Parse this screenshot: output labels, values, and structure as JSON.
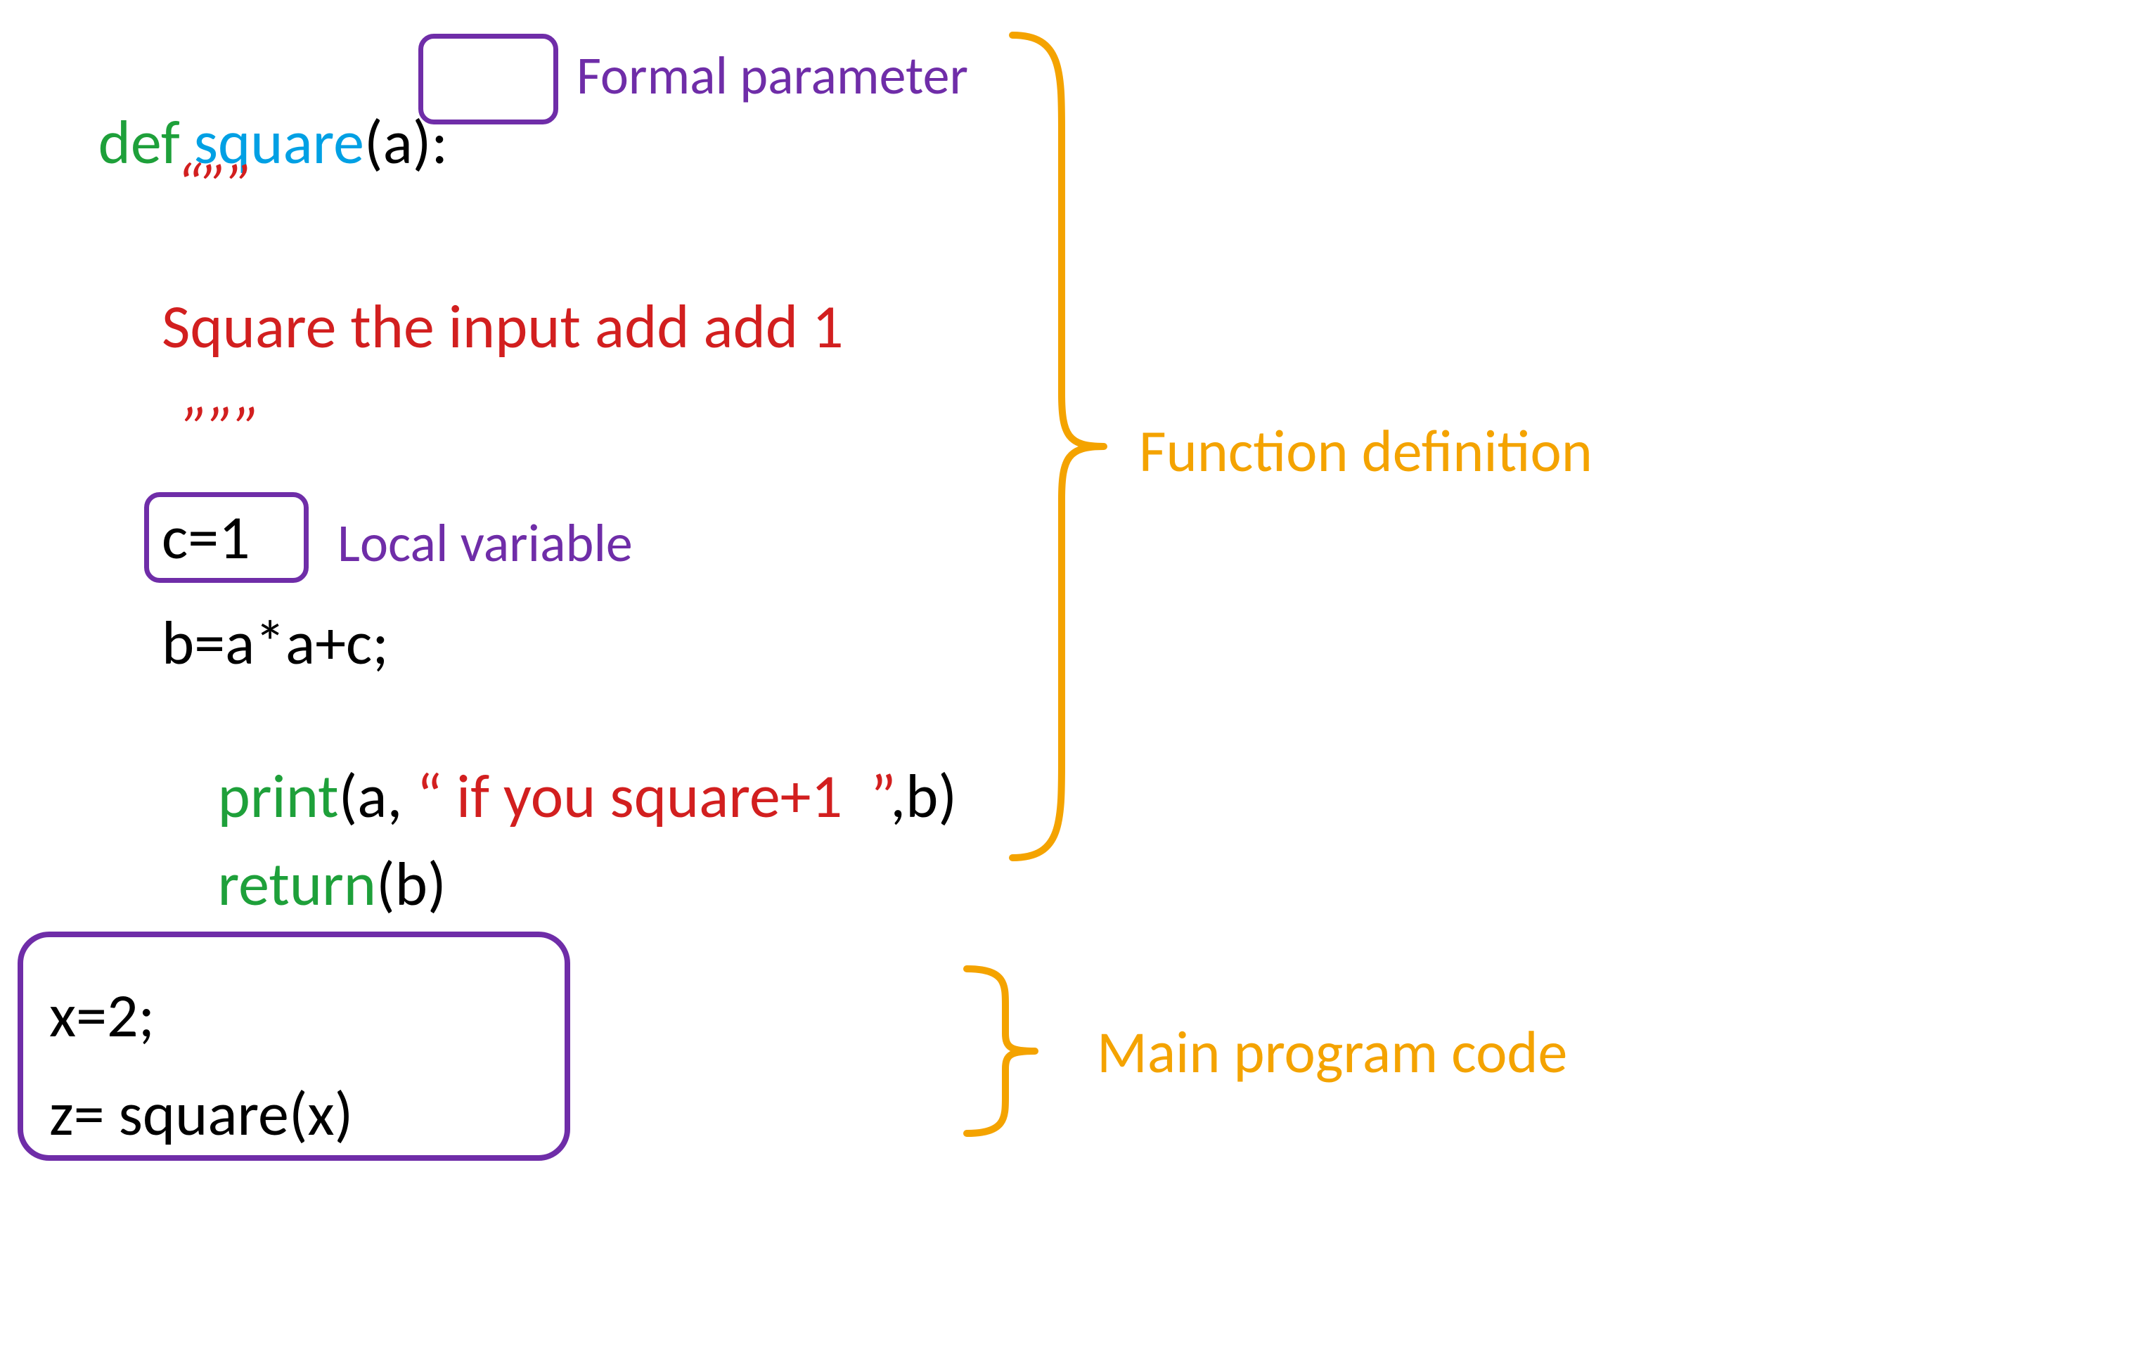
{
  "code": {
    "def_kw": "def ",
    "func_name": "square",
    "param_a": "(a)",
    "colon": ":",
    "doc_open": "“””",
    "doc_text": "Square the input add add 1",
    "doc_close": "”””",
    "c_assign": "c=1",
    "b_assign": "b=a*a+c;",
    "print_kw": "print",
    "print_open": "(a, ",
    "print_str": "“ if you square+1  ”",
    "print_close": ",b)",
    "return_kw": "return",
    "return_arg": "(b)",
    "main_l1": "x=2;",
    "main_l2": "z= square(x)"
  },
  "annotations": {
    "formal_param": "Formal parameter",
    "local_var": "Local variable",
    "func_def": "Function definition",
    "main_prog": "Main program code"
  },
  "colors": {
    "keyword_green": "#1ea03a",
    "name_blue": "#00a0e4",
    "string_red": "#d21f1f",
    "annotation_purple": "#6f2da8",
    "brace_orange": "#f4a300"
  }
}
